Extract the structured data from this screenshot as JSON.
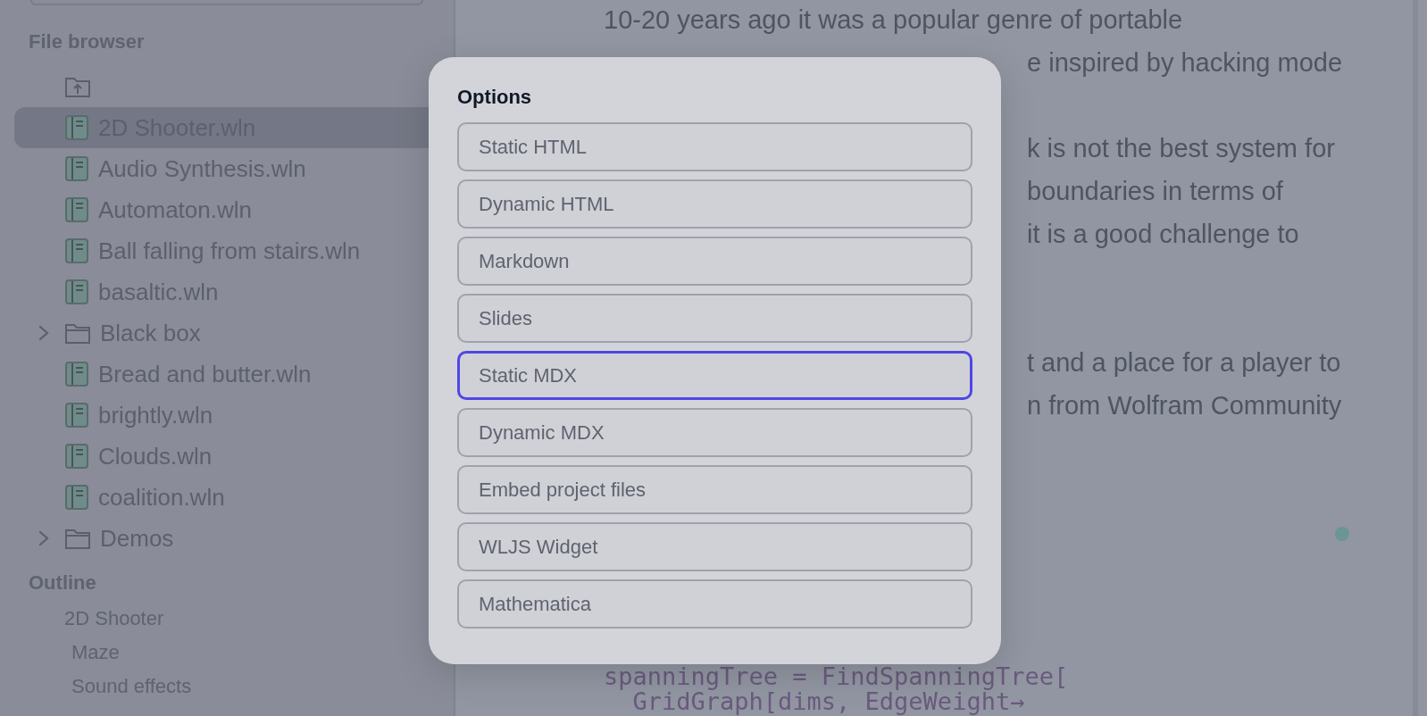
{
  "sidebar": {
    "file_browser": {
      "title": "File browser",
      "items": [
        {
          "kind": "up",
          "selected": false
        },
        {
          "kind": "file",
          "label": "2D Shooter.wln",
          "selected": true
        },
        {
          "kind": "file",
          "label": "Audio Synthesis.wln",
          "selected": false
        },
        {
          "kind": "file",
          "label": "Automaton.wln",
          "selected": false
        },
        {
          "kind": "file",
          "label": "Ball falling from stairs.wln",
          "selected": false
        },
        {
          "kind": "file",
          "label": "basaltic.wln",
          "selected": false
        },
        {
          "kind": "folder",
          "label": "Black box",
          "selected": false,
          "expanded": false
        },
        {
          "kind": "file",
          "label": "Bread and butter.wln",
          "selected": false
        },
        {
          "kind": "file",
          "label": "brightly.wln",
          "selected": false
        },
        {
          "kind": "file",
          "label": "Clouds.wln",
          "selected": false
        },
        {
          "kind": "file",
          "label": "coalition.wln",
          "selected": false
        },
        {
          "kind": "folder",
          "label": "Demos",
          "selected": false,
          "expanded": false
        }
      ]
    },
    "outline": {
      "title": "Outline",
      "items": [
        {
          "label": "2D Shooter",
          "children": [
            {
              "label": "Maze"
            },
            {
              "label": "Sound effects"
            }
          ]
        }
      ]
    }
  },
  "content": {
    "lines": [
      {
        "kind": "full",
        "text": "10-20 years ago it was a popular genre of portable"
      },
      {
        "kind": "fragment",
        "text": "e inspired by hacking mode"
      },
      {
        "kind": "gap"
      },
      {
        "kind": "fragment",
        "text": "k is not the best system for"
      },
      {
        "kind": "fragment",
        "text": "boundaries in terms of"
      },
      {
        "kind": "fragment",
        "text": "it is a good challenge to"
      },
      {
        "kind": "gap"
      },
      {
        "kind": "gap"
      },
      {
        "kind": "fragment",
        "text": "t and a place for a player to"
      },
      {
        "kind": "fragment",
        "text": "n from Wolfram Community"
      }
    ],
    "code": [
      "spanningTree = FindSpanningTree[",
      "  GridGraph[dims, EdgeWeight→"
    ]
  },
  "dialog": {
    "title": "Options",
    "options": [
      {
        "label": "Static HTML",
        "selected": false
      },
      {
        "label": "Dynamic HTML",
        "selected": false
      },
      {
        "label": "Markdown",
        "selected": false
      },
      {
        "label": "Slides",
        "selected": false
      },
      {
        "label": "Static MDX",
        "selected": true
      },
      {
        "label": "Dynamic MDX",
        "selected": false
      },
      {
        "label": "Embed project files",
        "selected": false
      },
      {
        "label": "WLJS Widget",
        "selected": false
      },
      {
        "label": "Mathematica",
        "selected": false
      }
    ]
  }
}
